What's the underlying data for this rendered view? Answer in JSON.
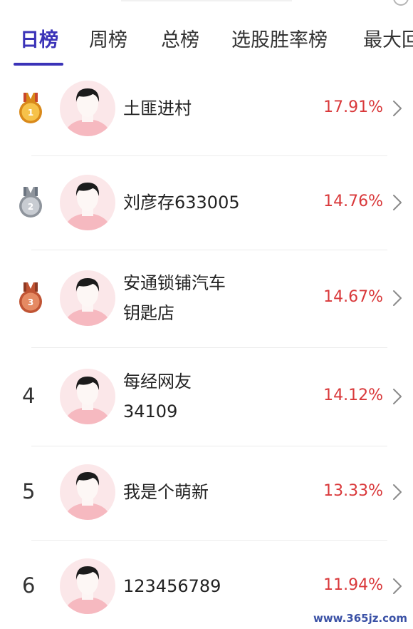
{
  "tabs": [
    {
      "label": "日榜",
      "active": true
    },
    {
      "label": "周榜",
      "active": false
    },
    {
      "label": "总榜",
      "active": false
    },
    {
      "label": "选股胜率榜",
      "active": false
    },
    {
      "label": "最大回",
      "active": false
    }
  ],
  "rows": [
    {
      "rank": "1",
      "medal": "gold",
      "name_lines": [
        "土匪进村"
      ],
      "percent": "17.91%"
    },
    {
      "rank": "2",
      "medal": "silver",
      "name_lines": [
        "刘彦存633005"
      ],
      "percent": "14.76%"
    },
    {
      "rank": "3",
      "medal": "bronze",
      "name_lines": [
        "安通锁铺汽车",
        "钥匙店"
      ],
      "percent": "14.67%"
    },
    {
      "rank": "4",
      "medal": null,
      "name_lines": [
        "每经网友",
        "34109"
      ],
      "percent": "14.12%"
    },
    {
      "rank": "5",
      "medal": null,
      "name_lines": [
        "我是个萌新"
      ],
      "percent": "13.33%"
    },
    {
      "rank": "6",
      "medal": null,
      "name_lines": [
        "123456789"
      ],
      "percent": "11.94%"
    }
  ],
  "watermark": "www.365jz.com",
  "colors": {
    "accent": "#3b33b8",
    "percent": "#d9383a",
    "gold": "#e8a21e",
    "silver": "#a6acb5",
    "bronze": "#cf6a45"
  },
  "icons": {
    "medal": "medal-icon",
    "avatar": "default-avatar-icon",
    "chevron": "chevron-right-icon",
    "info": "info-circle-icon"
  }
}
